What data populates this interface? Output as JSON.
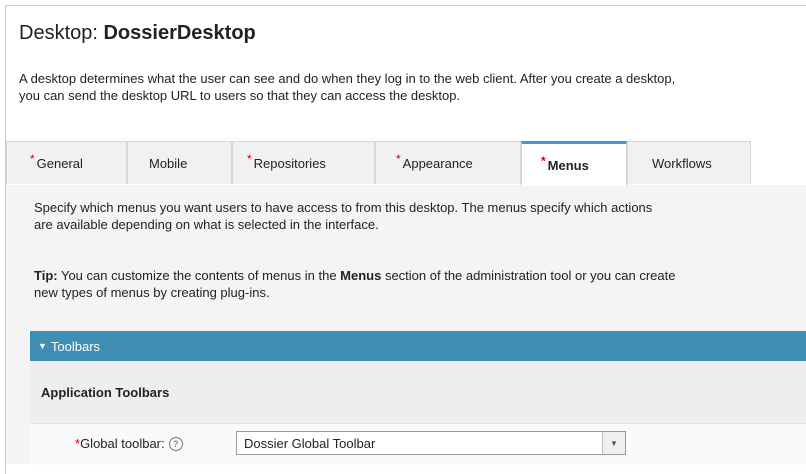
{
  "header": {
    "title_prefix": "Desktop: ",
    "title_name": "DossierDesktop",
    "description_line1": "A desktop determines what the user can see and do when they log in to the web client. After you create a desktop,",
    "description_line2": "you can send the desktop URL to users so that they can access the desktop."
  },
  "tabs": [
    {
      "label": "General",
      "required": "*"
    },
    {
      "label": "Mobile",
      "required": ""
    },
    {
      "label": "Repositories",
      "required": "*"
    },
    {
      "label": "Appearance",
      "required": "*"
    },
    {
      "label": "Menus",
      "required": "*",
      "active": true
    },
    {
      "label": "Workflows",
      "required": ""
    }
  ],
  "menus_tab": {
    "intro_line1": "Specify which menus you want users to have access to from this desktop. The menus specify which actions",
    "intro_line2": "are available depending on what is selected in the interface.",
    "tip_label": "Tip:",
    "tip_text1": " You can customize the contents of menus in the ",
    "tip_bold": "Menus",
    "tip_text2": " section of the administration tool or you can create",
    "tip_line2": "new types of menus by creating plug-ins.",
    "section_caret": "▼",
    "section_title": "Toolbars",
    "subheading": "Application Toolbars",
    "global_toolbar": {
      "required": "*",
      "label": "Global toolbar:",
      "help": "?",
      "value": "Dossier Global Toolbar",
      "arrow": "▼"
    }
  },
  "colors": {
    "accent_tab": "#3b9ad1",
    "section_bar": "#3f8fb5",
    "required": "#d20000"
  }
}
